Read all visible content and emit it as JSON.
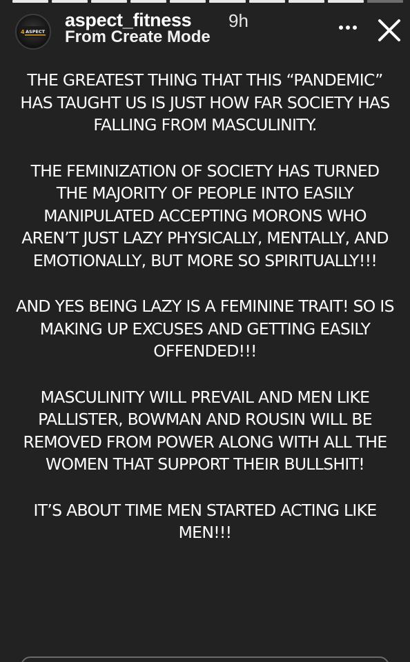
{
  "story": {
    "progress": {
      "total_segments": 10,
      "completed_segments": 9
    },
    "username": "aspect_fitness",
    "timestamp": "9h",
    "subtitle": "From Create Mode",
    "avatar_logo_text": "ASPECT",
    "icons": {
      "more": "more-options-icon",
      "close": "close-icon"
    },
    "paragraphs": [
      "THE GREATEST THING THAT THIS “PANDEMIC” HAS TAUGHT US IS JUST HOW FAR SOCIETY HAS FALLING FROM MASCULINITY.",
      "THE FEMINIZATION OF SOCIETY HAS TURNED THE MAJORITY OF PEOPLE INTO EASILY MANIPULATED ACCEPTING MORONS WHO AREN’T JUST LAZY PHYSICALLY, MENTALLY, AND EMOTIONALLY, BUT MORE SO SPIRITUALLY!!!",
      "AND YES BEING LAZY IS A FEMININE TRAIT! SO IS MAKING UP EXCUSES AND GETTING EASILY OFFENDED!!!",
      "MASCULINITY WILL PREVAIL AND MEN LIKE PALLISTER, BOWMAN AND ROUSIN WILL BE REMOVED FROM POWER ALONG WITH ALL THE WOMEN THAT SUPPORT THEIR BULLSHIT!",
      "IT’S ABOUT TIME MEN STARTED ACTING LIKE MEN!!!"
    ]
  },
  "colors": {
    "background": "#222222",
    "text": "#ffffff",
    "progress_done": "#e8e8e8",
    "progress_pending": "#6d6d6d"
  }
}
